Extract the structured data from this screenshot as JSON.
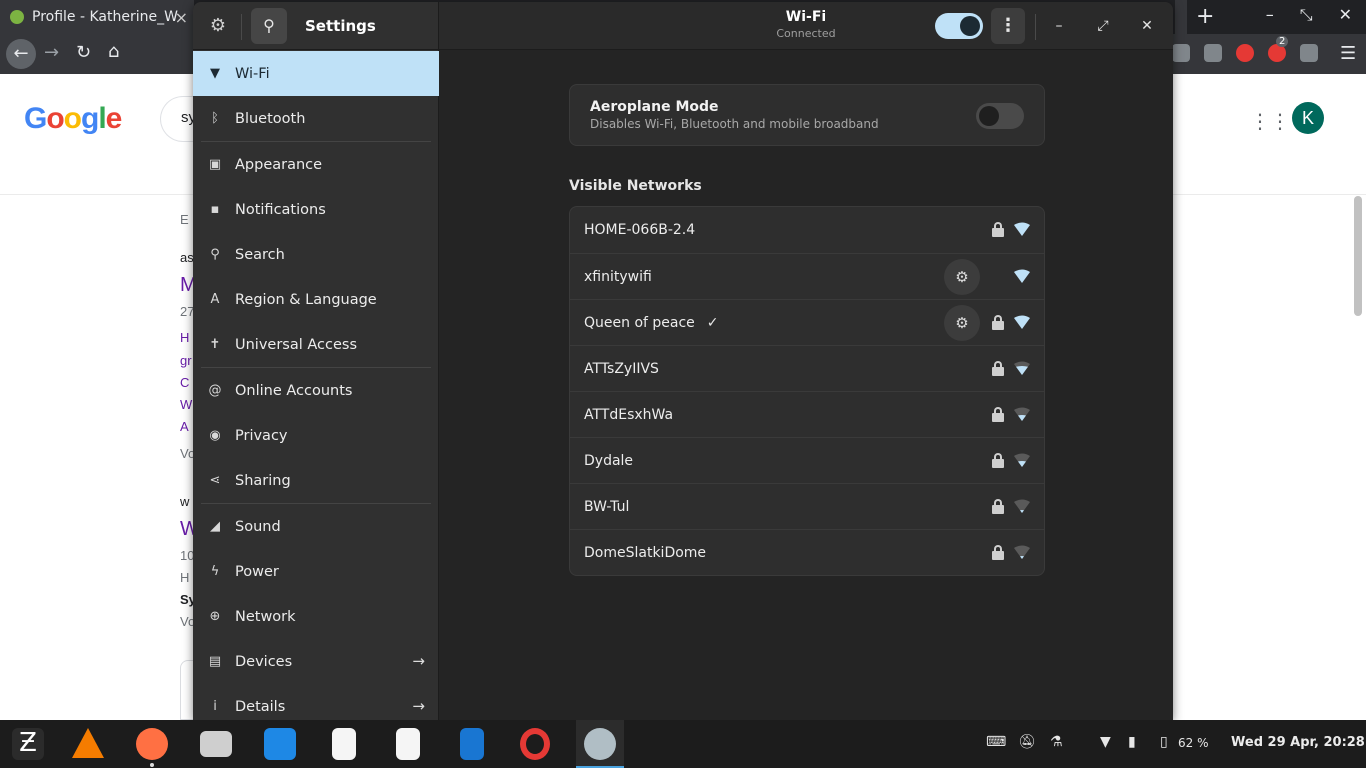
{
  "browser": {
    "tab_title": "Profile - Katherine_W",
    "tab_close": "×",
    "new_tab": "+",
    "ext_badge": "2",
    "window_buttons": [
      "–",
      "⤡",
      "✕"
    ]
  },
  "google": {
    "search_text": "sy",
    "avatar_letter": "K",
    "result_fragments": [
      "E",
      "as",
      "M",
      "27",
      "H",
      "gr",
      "C",
      "W",
      "A",
      "Vo",
      "w",
      "W",
      "10",
      "H",
      "Sy",
      "Vo"
    ]
  },
  "settings": {
    "sidebar_title": "Settings",
    "items": [
      {
        "label": "Wi-Fi",
        "icon": "wifi-icon",
        "glyph": "▼",
        "active": true
      },
      {
        "label": "Bluetooth",
        "icon": "bluetooth-icon",
        "glyph": "ᛒ"
      },
      {
        "label": "Appearance",
        "icon": "appearance-icon",
        "glyph": "▣"
      },
      {
        "label": "Notifications",
        "icon": "notifications-icon",
        "glyph": "▪"
      },
      {
        "label": "Search",
        "icon": "search-icon",
        "glyph": "⚲"
      },
      {
        "label": "Region & Language",
        "icon": "region-language-icon",
        "glyph": "A"
      },
      {
        "label": "Universal Access",
        "icon": "universal-access-icon",
        "glyph": "✝"
      },
      {
        "label": "Online Accounts",
        "icon": "online-accounts-icon",
        "glyph": "@"
      },
      {
        "label": "Privacy",
        "icon": "privacy-icon",
        "glyph": "◉"
      },
      {
        "label": "Sharing",
        "icon": "sharing-icon",
        "glyph": "⋖"
      },
      {
        "label": "Sound",
        "icon": "sound-icon",
        "glyph": "◢"
      },
      {
        "label": "Power",
        "icon": "power-icon",
        "glyph": "ϟ"
      },
      {
        "label": "Network",
        "icon": "network-icon",
        "glyph": "⊕"
      },
      {
        "label": "Devices",
        "icon": "devices-icon",
        "glyph": "▤",
        "arrow": "→"
      },
      {
        "label": "Details",
        "icon": "details-icon",
        "glyph": "i",
        "arrow": "→"
      }
    ],
    "header": {
      "title": "Wi-Fi",
      "subtitle": "Connected",
      "wifi_enabled": true
    },
    "window_controls": {
      "minimize": "–",
      "maximize": "⤢",
      "close": "✕"
    },
    "aeroplane": {
      "title": "Aeroplane Mode",
      "subtitle": "Disables Wi-Fi, Bluetooth and mobile broadband",
      "enabled": false
    },
    "visible_networks_title": "Visible Networks",
    "networks": [
      {
        "name": "HOME-066B-2.4",
        "secured": true,
        "signal": 4,
        "settings_button": false,
        "connected": false
      },
      {
        "name": "xfinitywifi",
        "secured": false,
        "signal": 4,
        "settings_button": true,
        "connected": false
      },
      {
        "name": "Queen of peace",
        "secured": true,
        "signal": 4,
        "settings_button": true,
        "connected": true
      },
      {
        "name": "ATTsZyIIVS",
        "secured": true,
        "signal": 3,
        "settings_button": false,
        "connected": false
      },
      {
        "name": "ATTdEsxhWa",
        "secured": true,
        "signal": 2,
        "settings_button": false,
        "connected": false
      },
      {
        "name": "Dydale",
        "secured": true,
        "signal": 2,
        "settings_button": false,
        "connected": false
      },
      {
        "name": "BW-Tul",
        "secured": true,
        "signal": 1,
        "settings_button": false,
        "connected": false
      },
      {
        "name": "DomeSlatkiDome",
        "secured": true,
        "signal": 1,
        "settings_button": false,
        "connected": false
      }
    ],
    "check_glyph": "✓",
    "gear_glyph": "⚙"
  },
  "taskbar": {
    "battery": "62 %",
    "clock": "Wed 29 Apr, 20:28"
  },
  "colors": {
    "accent": "#bfe1f7",
    "window_bg": "#242424",
    "sidebar_bg": "#303030"
  }
}
